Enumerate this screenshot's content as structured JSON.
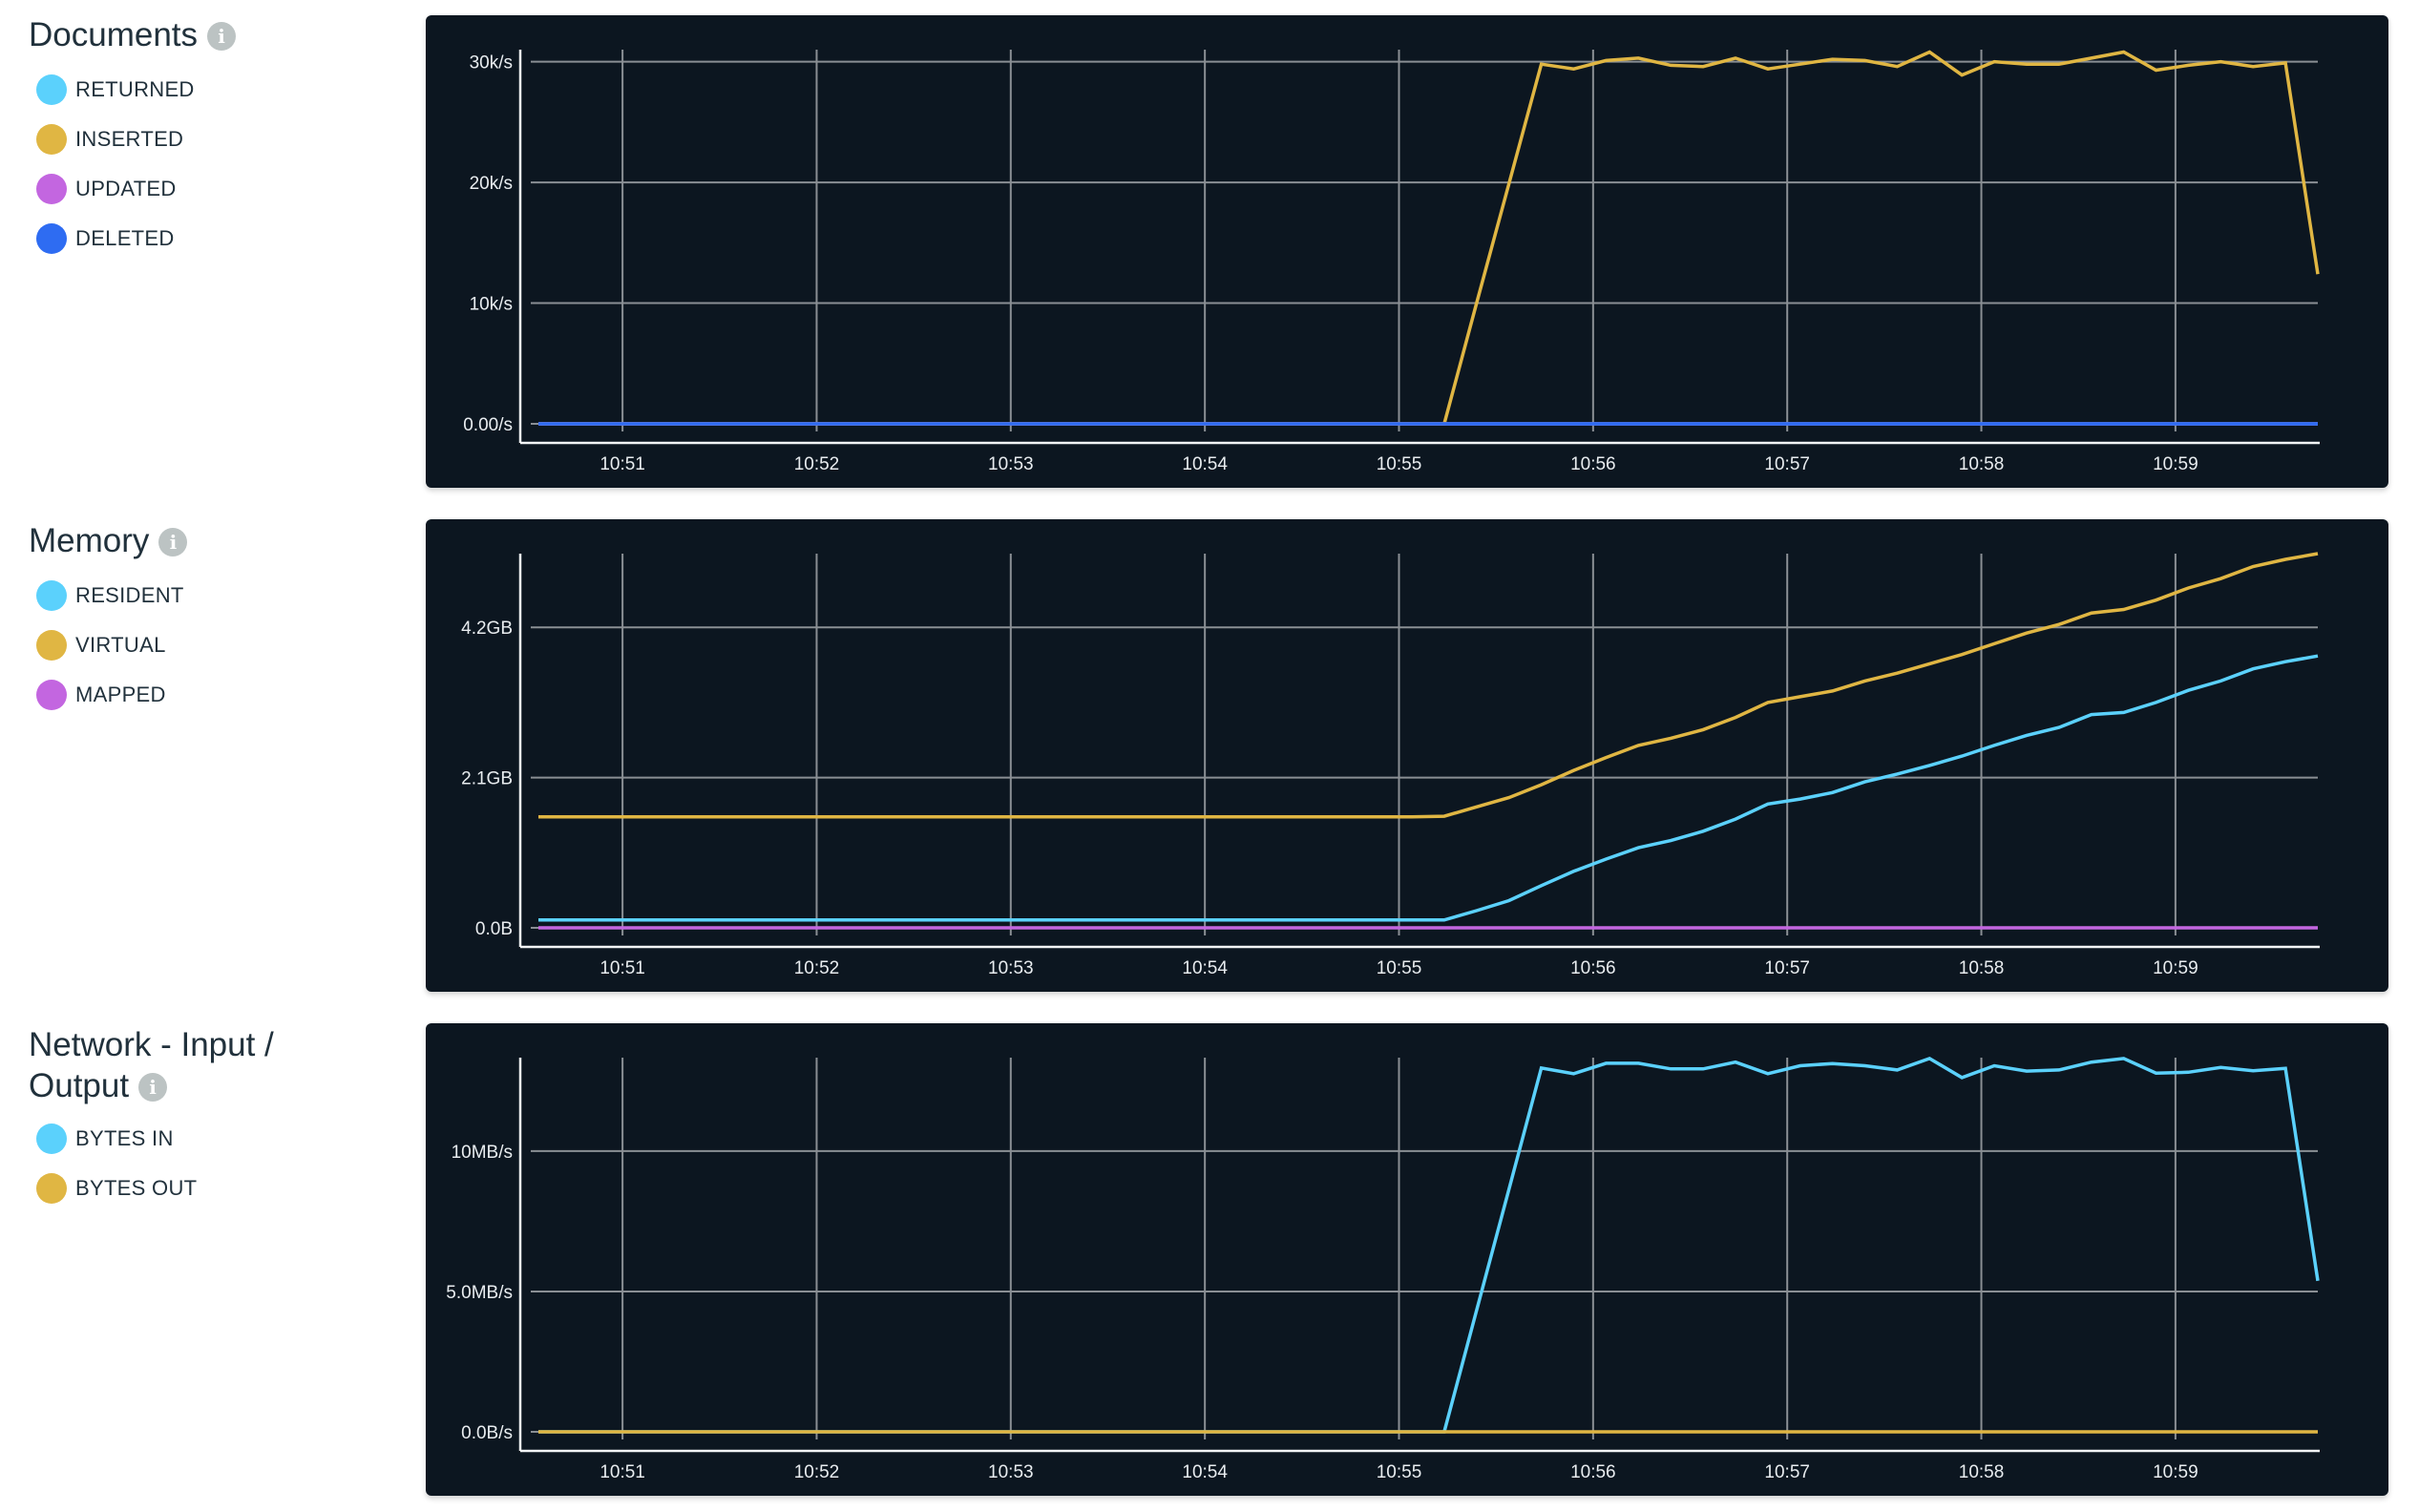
{
  "time_ticks": [
    "10:51",
    "10:52",
    "10:53",
    "10:54",
    "10:55",
    "10:56",
    "10:57",
    "10:58",
    "10:59"
  ],
  "sample_interval_seconds": 10,
  "start_time": "10:50:34",
  "chart_data": [
    {
      "type": "line",
      "title": "Documents",
      "ylabel": "",
      "xlabel": "",
      "y_ticks": [
        "0.00/s",
        "10k/s",
        "20k/s",
        "30k/s"
      ],
      "y_tick_values": [
        0,
        10000,
        20000,
        30000
      ],
      "ylim": [
        0,
        31000
      ],
      "x_range": [
        "10:50:34",
        "10:59:44"
      ],
      "grid": true,
      "legend_position": "left",
      "series": [
        {
          "name": "RETURNED",
          "color": "#5bd1fc",
          "values": [
            0,
            0,
            0,
            0,
            0,
            0,
            0,
            0,
            0,
            0,
            0,
            0,
            0,
            0,
            0,
            0,
            0,
            0,
            0,
            0,
            0,
            0,
            0,
            0,
            0,
            0,
            0,
            0,
            0,
            0,
            0,
            0,
            0,
            0,
            0,
            0,
            0,
            0,
            0,
            0,
            0,
            0,
            0,
            0,
            0,
            0,
            0,
            0,
            0,
            0,
            0,
            0,
            0,
            0,
            0,
            0
          ]
        },
        {
          "name": "INSERTED",
          "color": "#e0b643",
          "values": [
            0,
            0,
            0,
            0,
            0,
            0,
            0,
            0,
            0,
            0,
            0,
            0,
            0,
            0,
            0,
            0,
            0,
            0,
            0,
            0,
            0,
            0,
            0,
            0,
            0,
            0,
            0,
            0,
            0,
            10000,
            19900,
            29800,
            29400,
            30100,
            30300,
            29700,
            29600,
            30300,
            29400,
            29800,
            30200,
            30100,
            29600,
            30800,
            28900,
            30000,
            29800,
            29800,
            30300,
            30800,
            29300,
            29700,
            30000,
            29600,
            29900,
            12400
          ]
        },
        {
          "name": "UPDATED",
          "color": "#c366e0",
          "values": [
            0,
            0,
            0,
            0,
            0,
            0,
            0,
            0,
            0,
            0,
            0,
            0,
            0,
            0,
            0,
            0,
            0,
            0,
            0,
            0,
            0,
            0,
            0,
            0,
            0,
            0,
            0,
            0,
            0,
            0,
            0,
            0,
            0,
            0,
            0,
            0,
            0,
            0,
            0,
            0,
            0,
            0,
            0,
            0,
            0,
            0,
            0,
            0,
            0,
            0,
            0,
            0,
            0,
            0,
            0,
            0
          ]
        },
        {
          "name": "DELETED",
          "color": "#2e6cf2",
          "values": [
            0,
            0,
            0,
            0,
            0,
            0,
            0,
            0,
            0,
            0,
            0,
            0,
            0,
            0,
            0,
            0,
            0,
            0,
            0,
            0,
            0,
            0,
            0,
            0,
            0,
            0,
            0,
            0,
            0,
            0,
            0,
            0,
            0,
            0,
            0,
            0,
            0,
            0,
            0,
            0,
            0,
            0,
            0,
            0,
            0,
            0,
            0,
            0,
            0,
            0,
            0,
            0,
            0,
            0,
            0,
            0
          ]
        }
      ]
    },
    {
      "type": "line",
      "title": "Memory",
      "ylabel": "",
      "xlabel": "",
      "y_ticks": [
        "0.0B",
        "2.1GB",
        "4.2GB"
      ],
      "y_tick_values": [
        0,
        2.1,
        4.2
      ],
      "unit": "GB",
      "ylim": [
        0,
        5.23
      ],
      "x_range": [
        "10:50:34",
        "10:59:44"
      ],
      "grid": true,
      "legend_position": "left",
      "series": [
        {
          "name": "RESIDENT",
          "color": "#5bd1fc",
          "values": [
            0.11,
            0.11,
            0.11,
            0.11,
            0.11,
            0.11,
            0.11,
            0.11,
            0.11,
            0.11,
            0.11,
            0.11,
            0.11,
            0.11,
            0.11,
            0.11,
            0.11,
            0.11,
            0.11,
            0.11,
            0.11,
            0.11,
            0.11,
            0.11,
            0.11,
            0.11,
            0.11,
            0.11,
            0.11,
            0.24,
            0.38,
            0.59,
            0.79,
            0.96,
            1.12,
            1.22,
            1.35,
            1.52,
            1.73,
            1.8,
            1.89,
            2.04,
            2.15,
            2.27,
            2.4,
            2.55,
            2.69,
            2.8,
            2.98,
            3.01,
            3.15,
            3.32,
            3.45,
            3.62,
            3.72,
            3.8
          ]
        },
        {
          "name": "VIRTUAL",
          "color": "#e0b643",
          "values": [
            1.55,
            1.55,
            1.55,
            1.55,
            1.55,
            1.55,
            1.55,
            1.55,
            1.55,
            1.55,
            1.55,
            1.55,
            1.55,
            1.55,
            1.55,
            1.55,
            1.55,
            1.55,
            1.55,
            1.55,
            1.55,
            1.55,
            1.55,
            1.55,
            1.55,
            1.55,
            1.55,
            1.55,
            1.56,
            1.69,
            1.82,
            2.0,
            2.2,
            2.38,
            2.55,
            2.65,
            2.77,
            2.94,
            3.15,
            3.23,
            3.31,
            3.45,
            3.56,
            3.69,
            3.82,
            3.97,
            4.12,
            4.24,
            4.4,
            4.45,
            4.58,
            4.75,
            4.88,
            5.05,
            5.15,
            5.23
          ]
        },
        {
          "name": "MAPPED",
          "color": "#c366e0",
          "values": [
            0,
            0,
            0,
            0,
            0,
            0,
            0,
            0,
            0,
            0,
            0,
            0,
            0,
            0,
            0,
            0,
            0,
            0,
            0,
            0,
            0,
            0,
            0,
            0,
            0,
            0,
            0,
            0,
            0,
            0,
            0,
            0,
            0,
            0,
            0,
            0,
            0,
            0,
            0,
            0,
            0,
            0,
            0,
            0,
            0,
            0,
            0,
            0,
            0,
            0,
            0,
            0,
            0,
            0,
            0,
            0
          ]
        }
      ]
    },
    {
      "type": "line",
      "title": "Network - Input / Output",
      "ylabel": "",
      "xlabel": "",
      "y_ticks": [
        "0.0B/s",
        "5.0MB/s",
        "10MB/s"
      ],
      "y_tick_values": [
        0,
        5,
        10
      ],
      "unit": "MB/s",
      "ylim": [
        0,
        13.33
      ],
      "x_range": [
        "10:50:34",
        "10:59:44"
      ],
      "grid": true,
      "legend_position": "left",
      "series": [
        {
          "name": "BYTES IN",
          "color": "#5bd1fc",
          "values": [
            0,
            0,
            0,
            0,
            0,
            0,
            0,
            0,
            0,
            0,
            0,
            0,
            0,
            0,
            0,
            0,
            0,
            0,
            0,
            0,
            0,
            0,
            0,
            0,
            0,
            0,
            0,
            0,
            0,
            4.33,
            8.64,
            12.96,
            12.76,
            13.13,
            13.13,
            12.93,
            12.93,
            13.17,
            12.76,
            13.04,
            13.12,
            13.04,
            12.89,
            13.3,
            12.62,
            13.04,
            12.85,
            12.89,
            13.17,
            13.3,
            12.78,
            12.81,
            12.98,
            12.86,
            12.95,
            5.38
          ]
        },
        {
          "name": "BYTES OUT",
          "color": "#e0b643",
          "values": [
            0,
            0,
            0,
            0,
            0,
            0,
            0,
            0,
            0,
            0,
            0,
            0,
            0,
            0,
            0,
            0,
            0,
            0,
            0,
            0,
            0,
            0,
            0,
            0,
            0,
            0,
            0,
            0,
            0,
            0,
            0,
            0,
            0,
            0,
            0,
            0,
            0,
            0,
            0,
            0,
            0,
            0,
            0,
            0,
            0,
            0,
            0,
            0,
            0,
            0,
            0,
            0,
            0,
            0,
            0,
            0
          ]
        }
      ]
    }
  ],
  "sections": [
    {
      "title_lines": [
        "Documents"
      ],
      "info_icon": "info-icon"
    },
    {
      "title_lines": [
        "Memory"
      ],
      "info_icon": "info-icon"
    },
    {
      "title_lines": [
        "Network - Input /",
        "Output"
      ],
      "info_icon": "info-icon"
    }
  ],
  "info_glyph": "i"
}
